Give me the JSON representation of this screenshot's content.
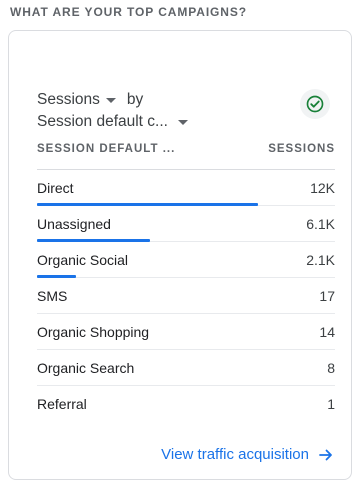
{
  "section": {
    "title": "WHAT ARE YOUR TOP CAMPAIGNS?"
  },
  "card": {
    "metric_selector": "Sessions",
    "by_word": "by",
    "dimension_selector": "Session default c...",
    "table": {
      "dimension_header": "SESSION DEFAULT ...",
      "metric_header": "SESSIONS",
      "rows": [
        {
          "label": "Direct",
          "value": "12K",
          "share": 0.74
        },
        {
          "label": "Unassigned",
          "value": "6.1K",
          "share": 0.38
        },
        {
          "label": "Organic Social",
          "value": "2.1K",
          "share": 0.13
        },
        {
          "label": "SMS",
          "value": "17",
          "share": 0
        },
        {
          "label": "Organic Shopping",
          "value": "14",
          "share": 0
        },
        {
          "label": "Organic Search",
          "value": "8",
          "share": 0
        },
        {
          "label": "Referral",
          "value": "1",
          "share": 0
        }
      ]
    },
    "footer_link": "View traffic acquisition"
  },
  "colors": {
    "accent": "#1a73e8",
    "success": "#188038"
  },
  "icons": {
    "status": "check-circle-icon",
    "footer": "arrow-right-icon"
  }
}
